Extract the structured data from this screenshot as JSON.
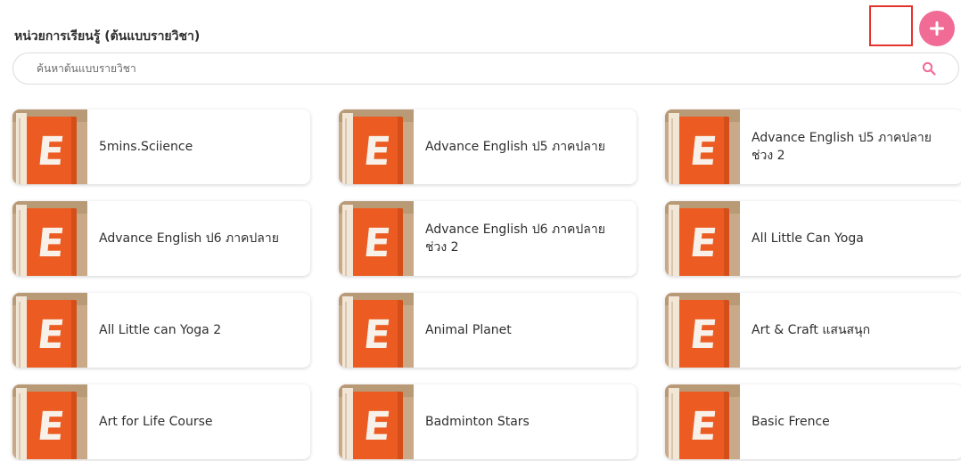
{
  "header": {
    "title": "หน่วยการเรียนรู้ (ต้นแบบรายวิชา)",
    "add_icon": "plus-icon",
    "accent_color": "#f06c96"
  },
  "search": {
    "placeholder": "ค้นหาต้นแบบรายวิชา",
    "value": "",
    "icon": "search-icon"
  },
  "courses": [
    {
      "title": "5mins.Sciience",
      "thumb_letter": "E"
    },
    {
      "title": "Advance English ป5 ภาคปลาย",
      "thumb_letter": "E"
    },
    {
      "title": "Advance English ป5 ภาคปลาย ช่วง 2",
      "thumb_letter": "E"
    },
    {
      "title": "Advance English ป6 ภาคปลาย",
      "thumb_letter": "E"
    },
    {
      "title": "Advance English ป6 ภาคปลาย ช่วง 2",
      "thumb_letter": "E"
    },
    {
      "title": "All Little Can Yoga",
      "thumb_letter": "E"
    },
    {
      "title": "All Little can Yoga 2",
      "thumb_letter": "E"
    },
    {
      "title": "Animal Planet",
      "thumb_letter": "E"
    },
    {
      "title": "Art & Craft แสนสนุก",
      "thumb_letter": "E"
    },
    {
      "title": "Art for Life Course",
      "thumb_letter": "E"
    },
    {
      "title": "Badminton Stars",
      "thumb_letter": "E"
    },
    {
      "title": "Basic Frence",
      "thumb_letter": "E"
    }
  ]
}
